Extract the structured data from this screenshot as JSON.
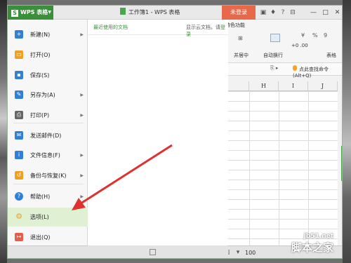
{
  "titlebar": {
    "app_button": "WPS 表格",
    "doc_title": "工作簿1 - WPS 表格",
    "login_button": "未登录",
    "icons": [
      "skin-icon",
      "shirt-icon",
      "help-icon",
      "restore-icon"
    ],
    "window_controls": [
      "—",
      "□",
      "✕"
    ]
  },
  "menu": {
    "items": [
      {
        "label": "新建(N)",
        "icon": "new-icon",
        "color": "#2f80d6",
        "arrow": true
      },
      {
        "label": "打开(O)",
        "icon": "open-icon",
        "color": "#f0a020",
        "arrow": false
      },
      {
        "label": "保存(S)",
        "icon": "save-icon",
        "color": "#2f80d6",
        "arrow": false
      },
      {
        "label": "另存为(A)",
        "icon": "save-as-icon",
        "color": "#2f80d6",
        "arrow": true
      },
      {
        "label": "打印(P)",
        "icon": "print-icon",
        "color": "#666666",
        "arrow": true
      },
      {
        "label": "发送邮件(D)",
        "icon": "mail-icon",
        "color": "#2f80d6",
        "arrow": false
      },
      {
        "label": "文件信息(F)",
        "icon": "file-info-icon",
        "color": "#2f80d6",
        "arrow": true
      },
      {
        "label": "备份与恢复(K)",
        "icon": "backup-icon",
        "color": "#f0a020",
        "arrow": true
      },
      {
        "label": "帮助(H)",
        "icon": "help-icon",
        "color": "#2f80d6",
        "arrow": true
      },
      {
        "label": "选项(L)",
        "icon": "options-gear-icon",
        "color": "#f0a020",
        "arrow": false
      },
      {
        "label": "退出(Q)",
        "icon": "exit-icon",
        "color": "#e85d4a",
        "arrow": false
      }
    ],
    "highlighted": "选项(L)"
  },
  "recent": {
    "title": "最近使用的文档",
    "cloud_hint_prefix": "显示云文档，请",
    "cloud_hint_link": "登录"
  },
  "ribbon": {
    "special_tab": "特色功能",
    "percent": "%",
    "comma": "9",
    "merge_label": "并居中",
    "wrap_label": "自动换行",
    "table_label": "表格",
    "dec_label": "+0 .00"
  },
  "formula_bar": {
    "search_hint": "点此查找命令 (Alt+Q)"
  },
  "sheet": {
    "columns": [
      "H",
      "I",
      "J"
    ]
  },
  "statusbar": {
    "zoom": "100"
  },
  "watermark": {
    "url": "jb51.net",
    "name": "脚本之家"
  },
  "colors": {
    "accent": "#3a8f3a",
    "login": "#e8694a",
    "highlight": "#dff0d3",
    "arrow": "#e03030"
  }
}
